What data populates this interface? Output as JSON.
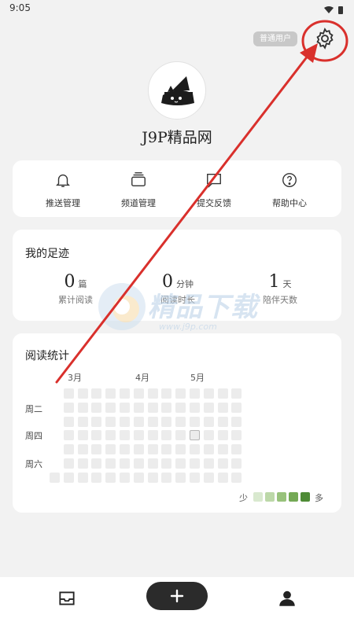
{
  "status_bar": {
    "time": "9:05"
  },
  "header": {
    "user_type_badge": "普通用户",
    "username": "J9P精品网"
  },
  "menu": {
    "items": [
      {
        "label": "推送管理",
        "icon": "bell-icon"
      },
      {
        "label": "频道管理",
        "icon": "layers-icon"
      },
      {
        "label": "提交反馈",
        "icon": "chat-icon"
      },
      {
        "label": "帮助中心",
        "icon": "help-icon"
      }
    ]
  },
  "footprint": {
    "title": "我的足迹",
    "stats": [
      {
        "value": "0",
        "unit": "篇",
        "label": "累计阅读"
      },
      {
        "value": "0",
        "unit": "分钟",
        "label": "阅读时长"
      },
      {
        "value": "1",
        "unit": "天",
        "label": "陪伴天数"
      }
    ]
  },
  "reading_stats": {
    "title": "阅读统计",
    "months": [
      "3月",
      "4月",
      "5月"
    ],
    "weekdays": [
      "周二",
      "周四",
      "周六"
    ],
    "legend_less": "少",
    "legend_more": "多",
    "legend_colors": [
      "#d9e9cf",
      "#bcd8a8",
      "#98c27b",
      "#74a955",
      "#4e8b36"
    ],
    "empty_color": "#ececec"
  },
  "watermark": {
    "text": "精品下载",
    "url": "www.j9p.com"
  },
  "bottom_nav": {
    "items": [
      "inbox-icon",
      "add-icon",
      "profile-icon"
    ]
  }
}
